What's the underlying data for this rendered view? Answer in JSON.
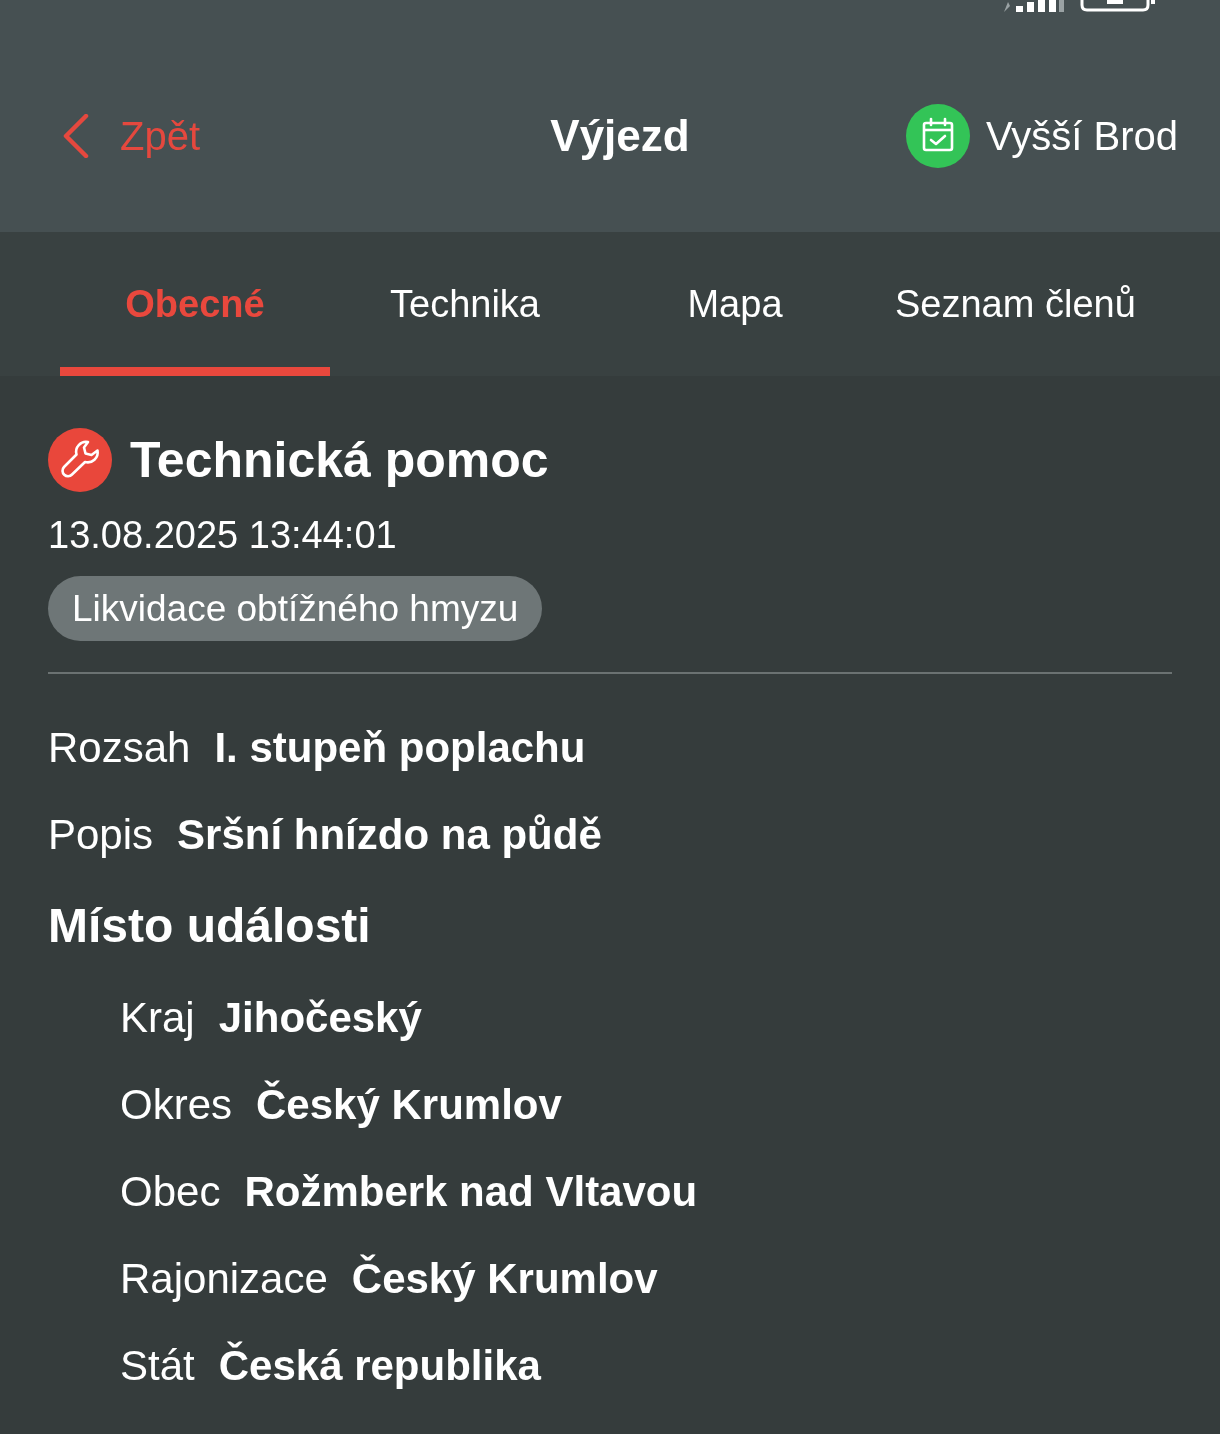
{
  "header": {
    "back": "Zpět",
    "title": "Výjezd",
    "unit": "Vyšší Brod"
  },
  "tabs": [
    {
      "label": "Obecné",
      "selected": true
    },
    {
      "label": "Technika",
      "selected": false
    },
    {
      "label": "Mapa",
      "selected": false
    },
    {
      "label": "Seznam členů",
      "selected": false
    }
  ],
  "incident": {
    "type": "Technická pomoc",
    "datetime": "13.08.2025 13:44:01",
    "tag": "Likvidace obtížného hmyzu"
  },
  "fields": [
    {
      "label": "Rozsah",
      "value": "I. stupeň poplachu"
    },
    {
      "label": "Popis",
      "value": "Sršní hnízdo na půdě"
    }
  ],
  "location": {
    "heading": "Místo události",
    "fields": [
      {
        "label": "Kraj",
        "value": "Jihočeský"
      },
      {
        "label": "Okres",
        "value": "Český Krumlov"
      },
      {
        "label": "Obec",
        "value": "Rožmberk nad Vltavou"
      },
      {
        "label": "Rajonizace",
        "value": "Český Krumlov"
      },
      {
        "label": "Stát",
        "value": "Česká republika"
      }
    ]
  }
}
